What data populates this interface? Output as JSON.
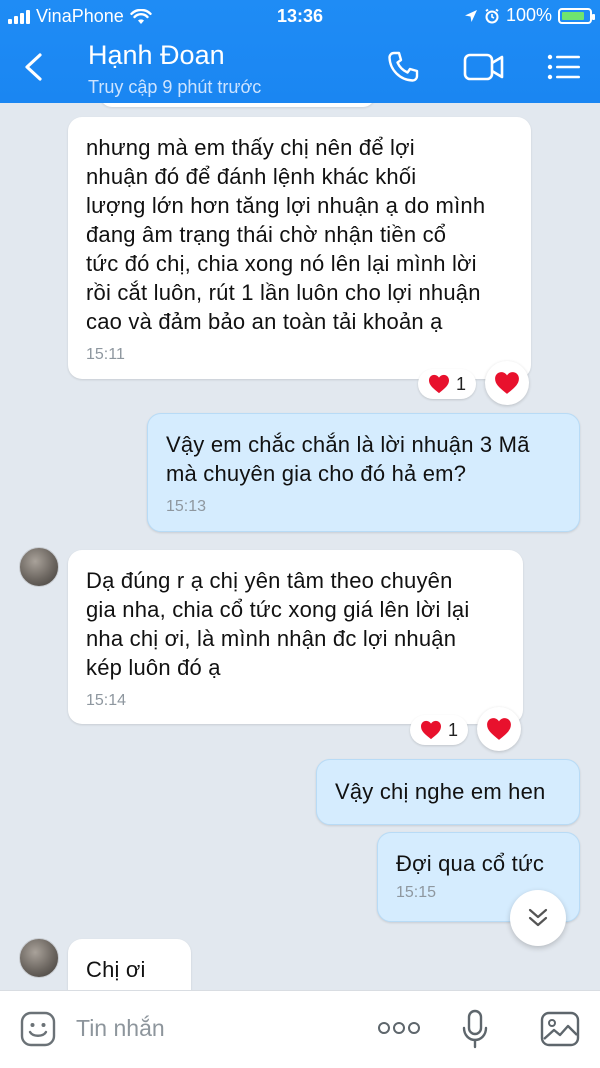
{
  "status_bar": {
    "carrier": "VinaPhone",
    "time": "13:36",
    "battery": "100%"
  },
  "header": {
    "name": "Hạnh Đoan",
    "subtitle": "Truy cập 9 phút trước",
    "icons": [
      "back-icon",
      "phone-icon",
      "video-icon",
      "menu-icon"
    ]
  },
  "messages": [
    {
      "direction": "in",
      "text": "nhưng mà em thấy chị nên để lợi\nnhuận đó để đánh lệnh khác khối\nlượng lớn hơn tăng lợi nhuận ạ do mình\nđang âm trạng thái chờ nhận tiền cổ\ntức đó chị, chia xong nó lên lại mình lời\nrồi cắt luôn, rút 1 lần luôn cho lợi nhuận\ncao và đảm bảo an toàn tải khoản ạ",
      "time": "15:11",
      "reaction_count": "1"
    },
    {
      "direction": "out",
      "text": "Vậy em chắc chắn là lời nhuận 3 Mã\nmà chuyên gia cho đó hả em?",
      "time": "15:13"
    },
    {
      "direction": "in",
      "text": "Dạ đúng r ạ chị yên tâm theo chuyên\ngia nha, chia cổ tức xong giá lên lời lại\nnha chị ơi, là mình nhận đc lợi nhuận\nkép luôn đó ạ",
      "time": "15:14",
      "reaction_count": "1"
    },
    {
      "direction": "out",
      "text": "Vậy chị nghe em hen",
      "time": ""
    },
    {
      "direction": "out",
      "text": "Đợi qua cổ tức",
      "time": "15:15"
    },
    {
      "direction": "in",
      "text": "Chị ơi",
      "time": ""
    }
  ],
  "input": {
    "placeholder": "Tin nhắn",
    "icons": [
      "emoji-icon",
      "more-icon",
      "microphone-icon",
      "image-icon"
    ]
  },
  "colors": {
    "header": "#1a86f2",
    "chat_bg": "#e2e8ef",
    "outgoing_bubble": "#d5ecfe",
    "incoming_bubble": "#ffffff",
    "heart": "#e8112d"
  }
}
